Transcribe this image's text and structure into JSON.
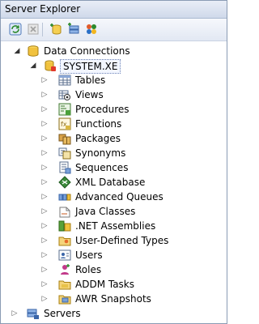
{
  "window": {
    "title": "Server Explorer"
  },
  "toolbar": {
    "buttons": [
      {
        "icon": "refresh-icon"
      },
      {
        "icon": "stop-icon"
      },
      {
        "icon": "connect-to-database-icon"
      },
      {
        "icon": "connect-to-server-icon"
      },
      {
        "icon": "sharepoint-connection-icon"
      }
    ]
  },
  "tree": {
    "root": {
      "label": "Data Connections",
      "expanded": true
    },
    "connection": {
      "label": "SYSTEM.XE",
      "expanded": true
    },
    "children": [
      {
        "label": "Tables",
        "icon": "tables-icon"
      },
      {
        "label": "Views",
        "icon": "views-icon"
      },
      {
        "label": "Procedures",
        "icon": "procedures-icon"
      },
      {
        "label": "Functions",
        "icon": "functions-icon"
      },
      {
        "label": "Packages",
        "icon": "packages-icon"
      },
      {
        "label": "Synonyms",
        "icon": "synonyms-icon"
      },
      {
        "label": "Sequences",
        "icon": "sequences-icon"
      },
      {
        "label": "XML Database",
        "icon": "xml-database-icon"
      },
      {
        "label": "Advanced Queues",
        "icon": "advanced-queues-icon"
      },
      {
        "label": "Java Classes",
        "icon": "java-classes-icon"
      },
      {
        "label": ".NET Assemblies",
        "icon": "net-assemblies-icon"
      },
      {
        "label": "User-Defined Types",
        "icon": "user-defined-types-icon"
      },
      {
        "label": "Users",
        "icon": "users-icon"
      },
      {
        "label": "Roles",
        "icon": "roles-icon"
      },
      {
        "label": "ADDM Tasks",
        "icon": "addm-tasks-icon"
      },
      {
        "label": "AWR Snapshots",
        "icon": "awr-snapshots-icon"
      }
    ],
    "servers": {
      "label": "Servers",
      "expanded": false
    }
  }
}
